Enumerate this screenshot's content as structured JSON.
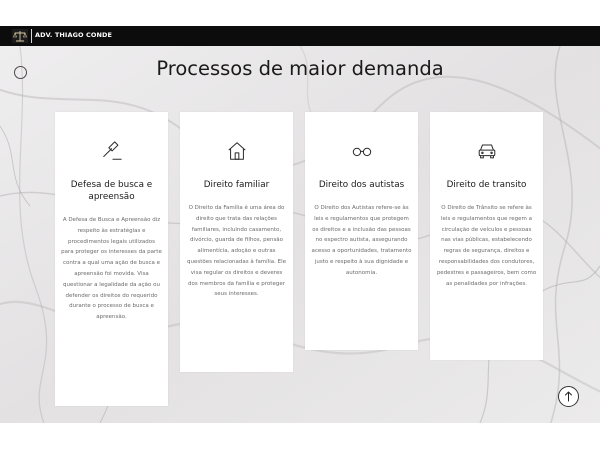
{
  "brand": {
    "name": "ADV. THIAGO CONDE",
    "logo": "scales-of-justice-logo"
  },
  "page": {
    "title": "Processos de maior demanda"
  },
  "cards": [
    {
      "icon": "gavel-icon",
      "title": "Defesa de busca e apreensão",
      "text": "A Defesa de Busca e Apreensão diz respeito às estratégias e procedimentos legais utilizados para proteger os interesses da parte contra a qual uma ação de busca e apreensão foi movida. Visa questionar a legalidade da ação ou defender os direitos do requerido durante o processo de busca e apreensão."
    },
    {
      "icon": "house-icon",
      "title": "Direito familiar",
      "text": "O Direito da Família é uma área do direito que trata das relações familiares, incluindo casamento, divórcio, guarda de filhos, pensão alimentícia, adoção e outras questões relacionadas à família. Ele visa regular os direitos e deveres dos membros da família e proteger seus interesses."
    },
    {
      "icon": "glasses-icon",
      "title": "Direito dos autistas",
      "text": "O Direito dos Autistas refere-se às leis e regulamentos que protegem os direitos e a inclusão das pessoas no espectro autista, assegurando acesso a oportunidades, tratamento justo e respeito à sua dignidade e autonomia."
    },
    {
      "icon": "car-icon",
      "title": "Direito de transito",
      "text": "O Direito de Trânsito se refere às leis e regulamentos que regem a circulação de veículos e pessoas nas vias públicas, estabelecendo regras de segurança, direitos e responsabilidades dos condutores, pedestres e passageiros, bem como as penalidades por infrações."
    }
  ],
  "icons": {
    "menu": "menu-circle-icon",
    "scroll_top": "arrow-up-icon"
  },
  "colors": {
    "topbar": "#0c0c0c",
    "card": "#ffffff",
    "title": "#1a1a1a",
    "body_text": "#6a6a6a"
  }
}
